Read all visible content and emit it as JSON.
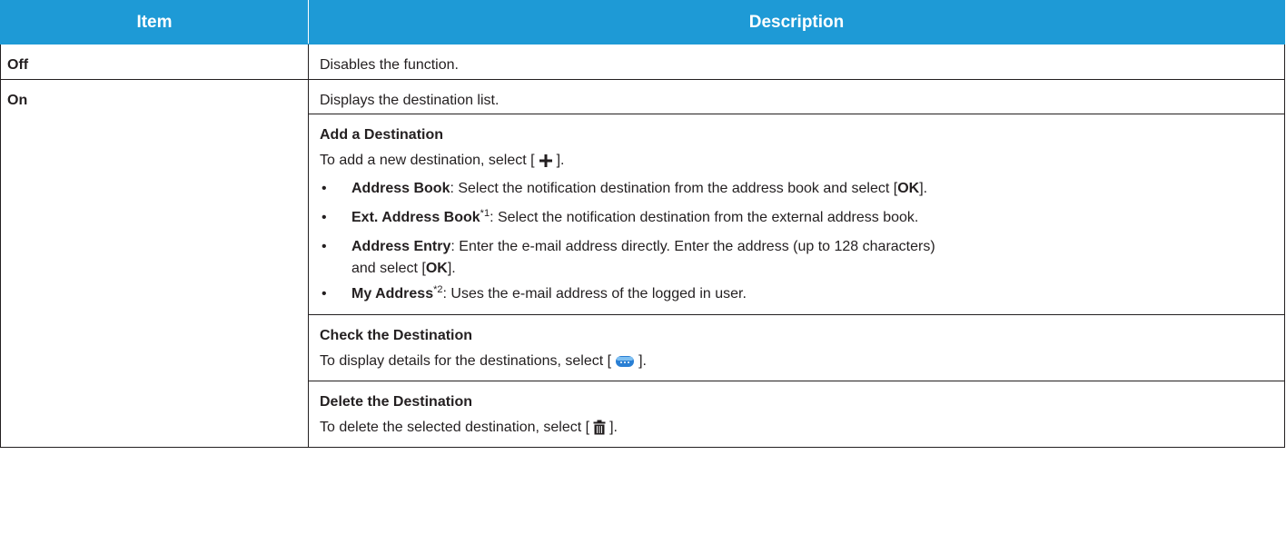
{
  "header": {
    "item": "Item",
    "description": "Description"
  },
  "rows": {
    "off": {
      "item": "Off",
      "description": "Disables the function."
    },
    "on": {
      "item": "On",
      "description": "Displays the destination list.",
      "add": {
        "title": "Add a Destination",
        "intro_prefix": "To add a new destination, select [",
        "intro_suffix": "].",
        "bullet": "•",
        "b1_bold": "Address Book",
        "b1_text": ": Select the notification destination from the address book and select [",
        "b1_ok": "OK",
        "b1_end": "].",
        "b2_bold": "Ext. Address Book",
        "b2_sup": "*1",
        "b2_text": ": Select the notification destination from the external address book.",
        "b3_bold": "Address Entry",
        "b3_text": ": Enter the e-mail address directly. Enter the address (up to 128 characters)",
        "b3_line2": "and select [",
        "b3_ok": "OK",
        "b3_end": "].",
        "b4_bold": "My Address",
        "b4_sup": "*2",
        "b4_text": ": Uses the e-mail address of the logged in user.",
        "icon": "plus-icon"
      },
      "check": {
        "title": "Check the Destination",
        "text_prefix": "To display details for the destinations, select [",
        "text_suffix": "].",
        "icon": "details-button-icon"
      },
      "delete": {
        "title": "Delete the Destination",
        "text_prefix": "To delete the selected destination, select [",
        "text_suffix": "].",
        "icon": "trash-icon"
      }
    }
  },
  "colors": {
    "header_bg": "#1e9ad6",
    "header_text": "#ffffff",
    "border": "#231f20",
    "icon_blue": "#2a7fd4"
  }
}
